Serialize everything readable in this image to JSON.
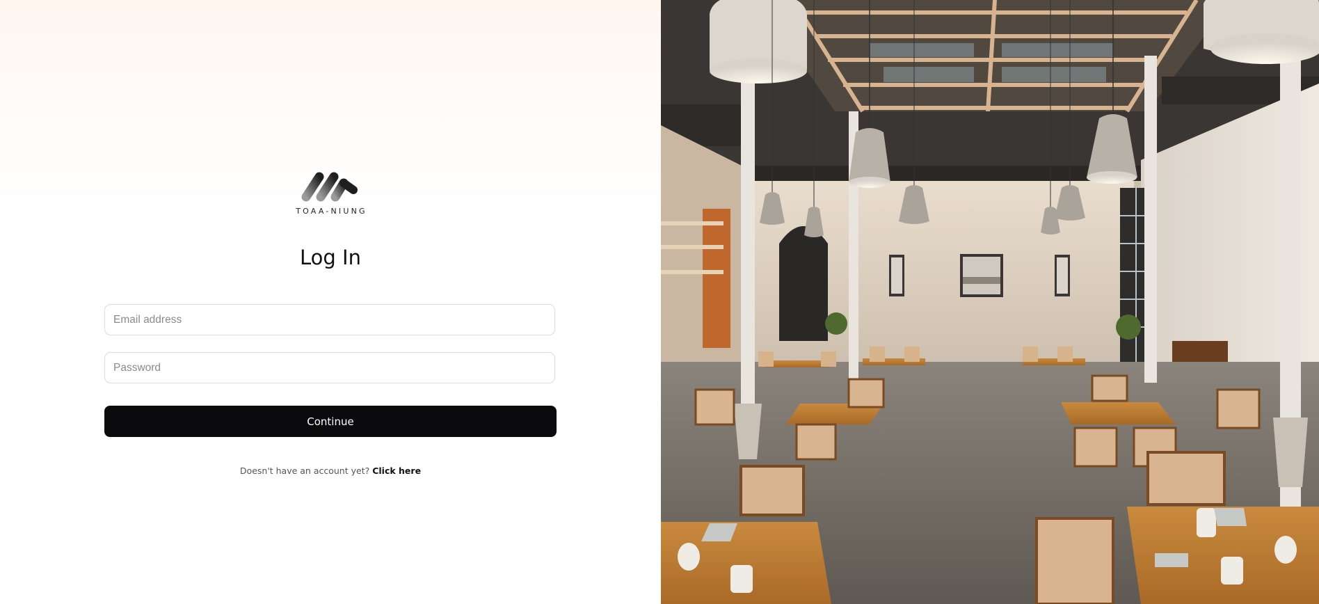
{
  "brand": {
    "name": "TOAA-NIUNG"
  },
  "login": {
    "title": "Log In",
    "email_placeholder": "Email address",
    "password_placeholder": "Password",
    "continue_label": "Continue",
    "signup_prompt": "Doesn't have an account yet?",
    "signup_link": "Click here"
  },
  "hero_image": {
    "subject": "restaurant-interior-photo"
  }
}
